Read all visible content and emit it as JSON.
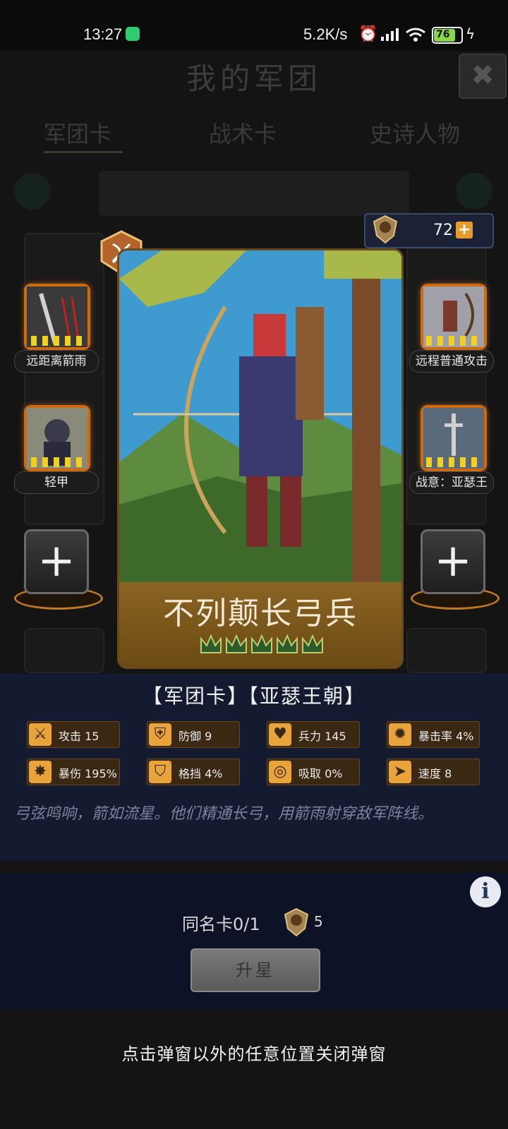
{
  "status_bar": {
    "time": "13:27",
    "net_speed": "5.2K/s",
    "battery": "76"
  },
  "background": {
    "title": "我的军团",
    "tabs": [
      "军团卡",
      "战术卡",
      "史诗人物"
    ]
  },
  "currency": {
    "amount": "72",
    "add_symbol": "+"
  },
  "card": {
    "name": "不列颠长弓兵",
    "star_count": 5,
    "level_badge_icon": "bow-badge-icon"
  },
  "slots": {
    "left": [
      {
        "label": "远距离箭雨",
        "icon": "arrow-rain-icon"
      },
      {
        "label": "轻甲",
        "icon": "light-armor-icon"
      }
    ],
    "right": [
      {
        "label": "远程普通攻击",
        "icon": "ranged-attack-icon"
      },
      {
        "label": "战意：亚瑟王",
        "icon": "king-arthur-icon"
      }
    ],
    "empty_symbol": "+"
  },
  "info": {
    "card_type": "【军团卡】【亚瑟王朝】",
    "stats": [
      {
        "label": "攻击 15",
        "icon": "sword-icon",
        "glyph": "⚔"
      },
      {
        "label": "防御 9",
        "icon": "shield-icon",
        "glyph": "⛨"
      },
      {
        "label": "兵力 145",
        "icon": "heart-icon",
        "glyph": "♥"
      },
      {
        "label": "暴击率 4%",
        "icon": "crit-rate-icon",
        "glyph": "✹"
      },
      {
        "label": "暴伤 195%",
        "icon": "crit-damage-icon",
        "glyph": "✸"
      },
      {
        "label": "格挡 4%",
        "icon": "block-icon",
        "glyph": "⛉"
      },
      {
        "label": "吸取 0%",
        "icon": "lifesteal-icon",
        "glyph": "◎"
      },
      {
        "label": "速度 8",
        "icon": "speed-icon",
        "glyph": "➤"
      }
    ],
    "description": "弓弦鸣响，箭如流星。他们精通长弓，用箭雨射穿敌军阵线。"
  },
  "upgrade": {
    "duplicate_text": "同名卡0/1",
    "cost": "5",
    "button_label": "升星",
    "info_symbol": "i"
  },
  "close_hint": "点击弹窗以外的任意位置关闭弹窗"
}
